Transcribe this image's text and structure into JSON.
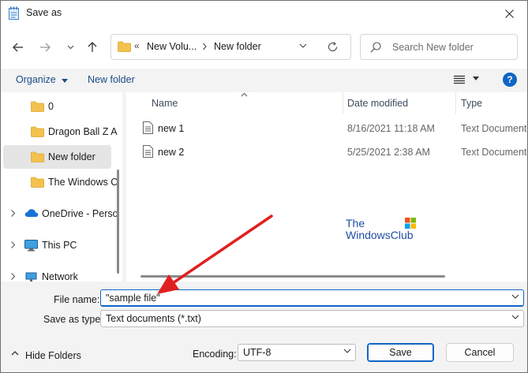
{
  "window": {
    "title": "Save as"
  },
  "nav": {
    "address_segments": [
      "New Volu...",
      "New folder"
    ],
    "address_prefix": "«",
    "search_placeholder": "Search New folder"
  },
  "commands": {
    "organize_label": "Organize",
    "new_folder_label": "New folder",
    "help_label": "?"
  },
  "sidebar": {
    "items": [
      {
        "label": "0",
        "icon": "folder-icon",
        "selected": false
      },
      {
        "label": "Dragon Ball Z A",
        "icon": "folder-icon",
        "selected": false
      },
      {
        "label": "New folder",
        "icon": "folder-icon",
        "selected": true
      },
      {
        "label": "The Windows C",
        "icon": "folder-icon",
        "selected": false
      },
      {
        "label": "OneDrive - Perso",
        "icon": "cloud-icon",
        "selected": false
      },
      {
        "label": "This PC",
        "icon": "pc-icon",
        "selected": false
      },
      {
        "label": "Network",
        "icon": "network-icon",
        "selected": false
      }
    ]
  },
  "files": {
    "columns": [
      "Name",
      "Date modified",
      "Type"
    ],
    "rows": [
      {
        "name": "new 1",
        "date": "8/16/2021 11:18 AM",
        "type": "Text Document"
      },
      {
        "name": "new 2",
        "date": "5/25/2021 2:38 AM",
        "type": "Text Document"
      }
    ]
  },
  "watermark": {
    "line1": "The",
    "line2": "WindowsClub"
  },
  "form": {
    "file_name_label": "File name:",
    "file_name_value": "\"sample file\"",
    "save_type_label": "Save as type:",
    "save_type_value": "Text documents (*.txt)",
    "encoding_label": "Encoding:",
    "encoding_value": "UTF-8",
    "hide_folders_label": "Hide Folders",
    "save_label": "Save",
    "cancel_label": "Cancel"
  },
  "colors": {
    "accent": "#0f66c5",
    "folder": "#f2c14e",
    "arrow": "#e02020",
    "link": "#1a4d86"
  }
}
